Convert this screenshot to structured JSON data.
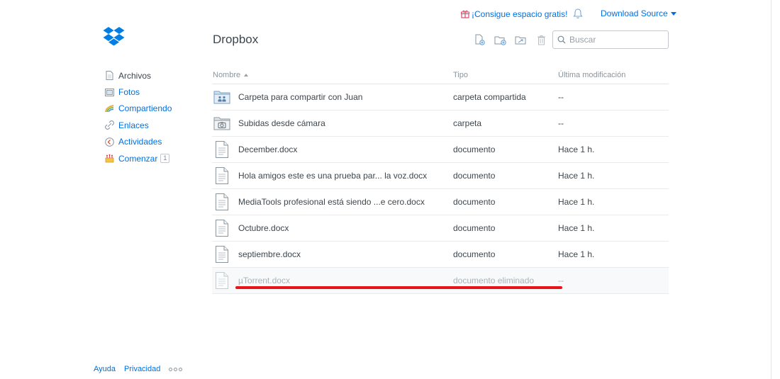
{
  "header": {
    "promo_label": "¡Consigue espacio gratis!",
    "account_label": "Download Source",
    "page_title": "Dropbox"
  },
  "search": {
    "placeholder": "Buscar"
  },
  "toolbar": {
    "items": [
      "upload-file-icon",
      "new-folder-icon",
      "shared-folder-icon",
      "delete-icon"
    ]
  },
  "sidebar": {
    "items": [
      {
        "label": "Archivos",
        "icon": "files-icon",
        "active": true
      },
      {
        "label": "Fotos",
        "icon": "photos-icon",
        "active": false
      },
      {
        "label": "Compartiendo",
        "icon": "sharing-icon",
        "active": false
      },
      {
        "label": "Enlaces",
        "icon": "links-icon",
        "active": false
      },
      {
        "label": "Actividades",
        "icon": "activity-icon",
        "active": false
      },
      {
        "label": "Comenzar",
        "icon": "get-started-icon",
        "active": false,
        "badge": "1"
      }
    ]
  },
  "table": {
    "headers": {
      "name": "Nombre",
      "type": "Tipo",
      "modified": "Última modificación"
    },
    "rows": [
      {
        "name": "Carpeta para compartir con Juan",
        "type": "carpeta compartida",
        "modified": "--",
        "icon": "shared-folder-icon"
      },
      {
        "name": "Subidas desde cámara",
        "type": "carpeta",
        "modified": "--",
        "icon": "camera-folder-icon"
      },
      {
        "name": "December.docx",
        "type": "documento",
        "modified": "Hace 1 h.",
        "icon": "document-icon"
      },
      {
        "name": "Hola amigos este es una prueba par... la voz.docx",
        "type": "documento",
        "modified": "Hace 1 h.",
        "icon": "document-icon"
      },
      {
        "name": "MediaTools profesional está siendo ...e cero.docx",
        "type": "documento",
        "modified": "Hace 1 h.",
        "icon": "document-icon"
      },
      {
        "name": "Octubre.docx",
        "type": "documento",
        "modified": "Hace 1 h.",
        "icon": "document-icon"
      },
      {
        "name": "septiembre.docx",
        "type": "documento",
        "modified": "Hace 1 h.",
        "icon": "document-icon"
      },
      {
        "name": "µTorrent.docx",
        "type": "documento eliminado",
        "modified": "--",
        "icon": "document-icon",
        "deleted": true
      }
    ]
  },
  "footer": {
    "help": "Ayuda",
    "privacy": "Privacidad"
  },
  "colors": {
    "link": "#0070e0",
    "brand": "#007ee5",
    "annotation": "#e8141c"
  }
}
